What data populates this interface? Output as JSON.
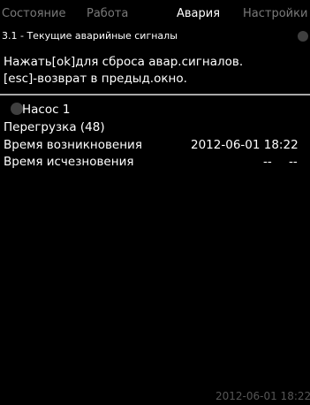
{
  "tabs": [
    {
      "label": "Состояние",
      "active": false
    },
    {
      "label": "Работа",
      "active": false
    },
    {
      "label": "Авария",
      "active": true
    },
    {
      "label": "Настройки",
      "active": false
    }
  ],
  "screen": {
    "title": "3.1 - Текущие аварийные сигналы",
    "instructions": [
      "Нажать[ok]для сброса авар.сигналов.",
      "[esc]-возврат в предыд.окно."
    ]
  },
  "alarm": {
    "icon": "alarm-icon",
    "source": "Насос 1",
    "cause": "Перегрузка (48)",
    "occurred_label": "Время возникновения",
    "occurred_value": "2012-06-01  18:22",
    "disappeared_label": "Время исчезновения",
    "disappeared_date": "--",
    "disappeared_time": "--"
  },
  "footer": {
    "datetime": "2012-06-01  18:22"
  },
  "colors": {
    "background": "#000000",
    "text": "#ffffff",
    "inactive_tab": "#7a7a7a",
    "divider": "#a8a8a8"
  }
}
